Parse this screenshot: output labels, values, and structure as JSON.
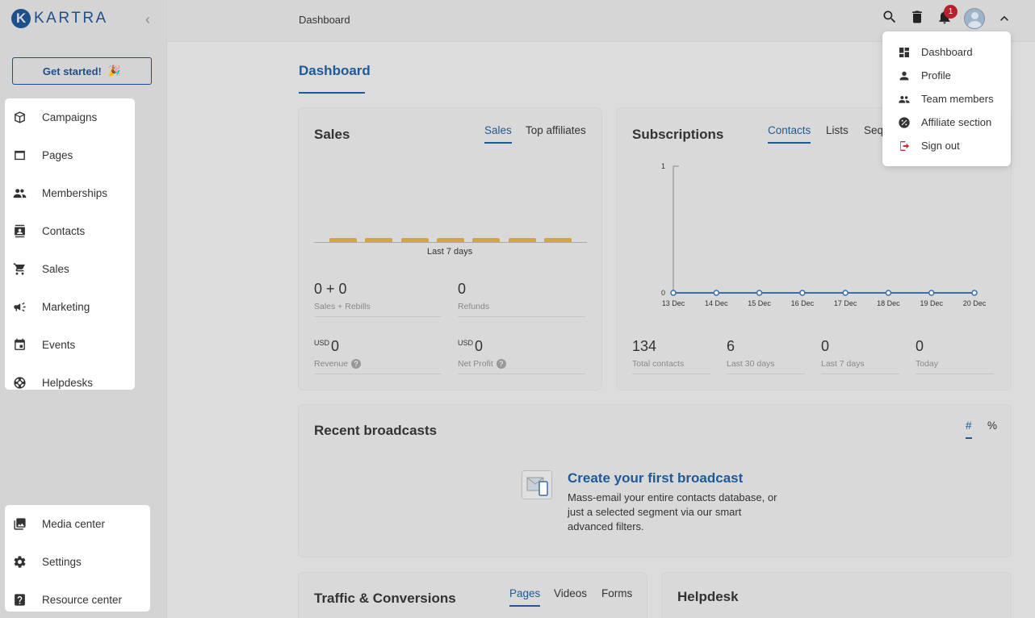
{
  "app": {
    "logo_text": "KARTRA"
  },
  "sidebar": {
    "get_started": "Get started!",
    "get_started_emoji": "🎉",
    "items": [
      {
        "label": "Campaigns",
        "icon": "campaigns-icon"
      },
      {
        "label": "Pages",
        "icon": "pages-icon"
      },
      {
        "label": "Memberships",
        "icon": "memberships-icon"
      },
      {
        "label": "Contacts",
        "icon": "contacts-icon"
      },
      {
        "label": "Sales",
        "icon": "cart-icon"
      },
      {
        "label": "Marketing",
        "icon": "megaphone-icon"
      },
      {
        "label": "Events",
        "icon": "calendar-icon"
      },
      {
        "label": "Helpdesks",
        "icon": "lifebuoy-icon"
      }
    ],
    "bottom_items": [
      {
        "label": "Media center",
        "icon": "media-icon"
      },
      {
        "label": "Settings",
        "icon": "gear-icon"
      },
      {
        "label": "Resource center",
        "icon": "help-icon"
      }
    ]
  },
  "topbar": {
    "breadcrumb": "Dashboard",
    "notification_count": "1"
  },
  "main": {
    "title": "Dashboard",
    "sales": {
      "title": "Sales",
      "tabs": [
        "Sales",
        "Top affiliates"
      ],
      "chart_caption": "Last 7 days",
      "bar_count": 7,
      "stats": [
        {
          "value": "0 + 0",
          "label": "Sales + Rebills"
        },
        {
          "value": "0",
          "label": "Refunds"
        },
        {
          "currency": "USD",
          "value": "0",
          "label": "Revenue"
        },
        {
          "currency": "USD",
          "value": "0",
          "label": "Net Profit"
        }
      ],
      "help_glyph": "?"
    },
    "subscriptions": {
      "title": "Subscriptions",
      "tabs": [
        "Contacts",
        "Lists",
        "Seq"
      ],
      "stats": [
        {
          "value": "134",
          "label": "Total contacts"
        },
        {
          "value": "6",
          "label": "Last 30 days"
        },
        {
          "value": "0",
          "label": "Last 7 days"
        },
        {
          "value": "0",
          "label": "Today"
        }
      ]
    },
    "broadcasts": {
      "title": "Recent broadcasts",
      "tabs": [
        "#",
        "%"
      ],
      "cta_title": "Create your first broadcast",
      "cta_text_1": "Mass-email your entire contacts database, or",
      "cta_text_2": "just a selected segment via our smart",
      "cta_text_3": "advanced filters."
    },
    "traffic": {
      "title": "Traffic & Conversions",
      "tabs": [
        "Pages",
        "Videos",
        "Forms"
      ]
    },
    "helpdesk": {
      "title": "Helpdesk"
    }
  },
  "dropdown": {
    "items": [
      {
        "label": "Dashboard",
        "icon": "dashboard-icon"
      },
      {
        "label": "Profile",
        "icon": "person-icon"
      },
      {
        "label": "Team members",
        "icon": "group-icon"
      },
      {
        "label": "Affiliate section",
        "icon": "percent-icon"
      },
      {
        "label": "Sign out",
        "icon": "logout-icon"
      }
    ]
  },
  "chart_data": {
    "type": "line",
    "x": [
      "13 Dec",
      "14 Dec",
      "15 Dec",
      "16 Dec",
      "17 Dec",
      "18 Dec",
      "19 Dec",
      "20 Dec"
    ],
    "series": [
      {
        "values": [
          0,
          0,
          0,
          0,
          0,
          0,
          0,
          0
        ]
      }
    ],
    "ylim": [
      0,
      1
    ],
    "yticks": [
      "0",
      "1"
    ],
    "color": "#3a6ea5"
  }
}
